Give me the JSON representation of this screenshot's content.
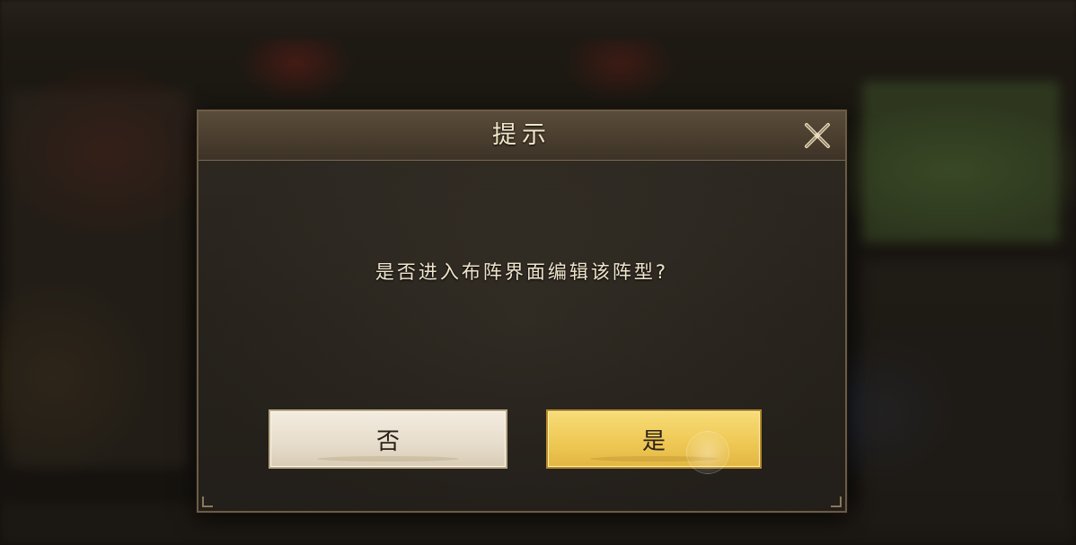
{
  "dialog": {
    "title": "提示",
    "message": "是否进入布阵界面编辑该阵型?",
    "no_label": "否",
    "yes_label": "是",
    "close_icon": "close-x-icon"
  },
  "colors": {
    "panel": "#302b23",
    "header": "#4a3e2f",
    "title_text": "#f2e6c8",
    "yes_button": "#efc955",
    "no_button": "#e6dccb"
  }
}
